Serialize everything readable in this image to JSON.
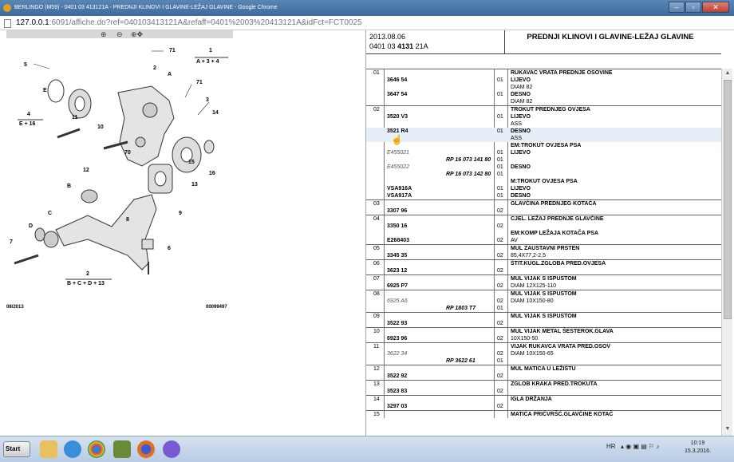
{
  "window": {
    "title": "BERLINGO (M59) - 0401 03 413121A - PREDNJI KLINOVI I GLAVINE-LEŽAJ GLAVINE - Google Chrome"
  },
  "address": {
    "host": "127.0.0.1",
    "rest": ":6091/affiche.do?ref=040103413121A&refaff=0401%2003%20413121A&idFct=FCT0025"
  },
  "diagram": {
    "footer_left": "08/2013",
    "footer_right": "00099497",
    "labels": [
      "1",
      "A + 3 + 4",
      "5",
      "E",
      "71",
      "2",
      "A",
      "4",
      "E + 16",
      "11",
      "71",
      "3",
      "14",
      "10",
      "70",
      "15",
      "16",
      "12",
      "B",
      "13",
      "9",
      "8",
      "C",
      "D",
      "7",
      "6",
      "2",
      "B + C + D + 13"
    ]
  },
  "header": {
    "date": "2013.08.06",
    "code_prefix": "0401 03",
    "code_bold": "4131",
    "code_suffix": "21A",
    "title": "PREDNJI KLINOVI I GLAVINE-LEŽAJ GLAVINE"
  },
  "groups": [
    {
      "num": "01",
      "rows": [
        {
          "ref": "",
          "qty": "",
          "text": "RUKAVAC VRATA PREDNJE OSOVINE",
          "bold": true
        },
        {
          "ref": "3646 54",
          "qty": "01",
          "text": "LIJEVO",
          "bold": true
        },
        {
          "ref": "",
          "qty": "",
          "text": "DIAM 82",
          "bold": false
        },
        {
          "ref": "3647 54",
          "qty": "01",
          "text": "DESNO",
          "bold": true
        },
        {
          "ref": "",
          "qty": "",
          "text": "DIAM 82",
          "bold": false
        }
      ]
    },
    {
      "num": "02",
      "rows": [
        {
          "ref": "",
          "qty": "",
          "text": "TROKUT PREDNJEG OVJESA",
          "bold": true
        },
        {
          "ref": "3520 V3",
          "qty": "01",
          "text": "LIJEVO",
          "bold": true
        },
        {
          "ref": "",
          "qty": "",
          "text": "ASS",
          "bold": false
        },
        {
          "ref": "3521 R4",
          "qty": "01",
          "text": "DESNO",
          "bold": true,
          "hl": true
        },
        {
          "ref": "",
          "qty": "",
          "text": "ASS",
          "bold": false,
          "hl": true
        },
        {
          "ref": "",
          "qty": "",
          "text": "EM:TROKUT OVJESA PSA",
          "bold": true
        },
        {
          "ref": "E455021",
          "qty": "01",
          "text": "LIJEVO",
          "bold": true,
          "italic": true
        },
        {
          "ref": "",
          "rp": "RP 16 073 141 80",
          "qty": "01",
          "text": ""
        },
        {
          "ref": "E455022",
          "qty": "01",
          "text": "DESNO",
          "bold": true,
          "italic": true
        },
        {
          "ref": "",
          "rp": "RP 16 073 142 80",
          "qty": "01",
          "text": ""
        },
        {
          "ref": "",
          "qty": "",
          "text": "M:TROKUT OVJESA PSA",
          "bold": true
        },
        {
          "ref": "VSA916A",
          "qty": "01",
          "text": "LIJEVO",
          "bold": true
        },
        {
          "ref": "VSA917A",
          "qty": "01",
          "text": "DESNO",
          "bold": true
        }
      ]
    },
    {
      "num": "03",
      "rows": [
        {
          "ref": "",
          "qty": "",
          "text": "GLAVČINA PREDNJEG KOTAČA",
          "bold": true
        },
        {
          "ref": "3307 96",
          "qty": "02",
          "text": "",
          "bold": false
        }
      ]
    },
    {
      "num": "04",
      "rows": [
        {
          "ref": "",
          "qty": "",
          "text": "CJEL. LEŽAJ PREDNJE GLAVČINE",
          "bold": true
        },
        {
          "ref": "3350 16",
          "qty": "02",
          "text": "",
          "bold": false
        },
        {
          "ref": "",
          "qty": "",
          "text": "EM:KOMP LEŽAJA KOTAČA PSA",
          "bold": true
        },
        {
          "ref": "E268403",
          "qty": "02",
          "text": "AV",
          "bold": false
        }
      ]
    },
    {
      "num": "05",
      "rows": [
        {
          "ref": "",
          "qty": "",
          "text": "MUL ZAUSTAVNI PRSTEN",
          "bold": true
        },
        {
          "ref": "3345 35",
          "qty": "02",
          "text": "85,4X77,2-2,5",
          "bold": false
        }
      ]
    },
    {
      "num": "06",
      "rows": [
        {
          "ref": "",
          "qty": "",
          "text": "ŠTIT.KUGL.ZGLOBA PRED.OVJESA",
          "bold": true
        },
        {
          "ref": "3623 12",
          "qty": "02",
          "text": "",
          "bold": false
        }
      ]
    },
    {
      "num": "07",
      "rows": [
        {
          "ref": "",
          "qty": "",
          "text": "MUL VIJAK S ISPUSTOM",
          "bold": true
        },
        {
          "ref": "6925 P7",
          "qty": "02",
          "text": "DIAM 12X125-110",
          "bold": false
        }
      ]
    },
    {
      "num": "08",
      "rows": [
        {
          "ref": "",
          "qty": "",
          "text": "MUL VIJAK S ISPUSTOM",
          "bold": true
        },
        {
          "ref": "6925 A6",
          "qty": "02",
          "text": "DIAM 10X150-80",
          "bold": false,
          "italic": true
        },
        {
          "ref": "",
          "rp": "RP 1803 T7",
          "qty": "01",
          "text": ""
        }
      ]
    },
    {
      "num": "09",
      "rows": [
        {
          "ref": "",
          "qty": "",
          "text": "MUL VIJAK S ISPUSTOM",
          "bold": true
        },
        {
          "ref": "3522 93",
          "qty": "02",
          "text": "",
          "bold": false
        }
      ]
    },
    {
      "num": "10",
      "rows": [
        {
          "ref": "",
          "qty": "",
          "text": "MUL VIJAK METAL ŠESTEROK.GLAVA",
          "bold": true
        },
        {
          "ref": "6923 96",
          "qty": "02",
          "text": "10X150-50",
          "bold": false
        }
      ]
    },
    {
      "num": "11",
      "rows": [
        {
          "ref": "",
          "qty": "",
          "text": "VIJAK RUKAVCA VRATA PRED.OSOV",
          "bold": true
        },
        {
          "ref": "3622 34",
          "qty": "02",
          "text": "DIAM 10X150-65",
          "bold": false,
          "italic": true
        },
        {
          "ref": "",
          "rp": "RP 3622 61",
          "qty": "01",
          "text": ""
        }
      ]
    },
    {
      "num": "12",
      "rows": [
        {
          "ref": "",
          "qty": "",
          "text": "MUL MATICA U LEŽIŠTU",
          "bold": true
        },
        {
          "ref": "3522 92",
          "qty": "02",
          "text": "",
          "bold": false
        }
      ]
    },
    {
      "num": "13",
      "rows": [
        {
          "ref": "",
          "qty": "",
          "text": "ZGLOB KRAKA PRED.TROKUTA",
          "bold": true
        },
        {
          "ref": "3523 83",
          "qty": "02",
          "text": "",
          "bold": false
        }
      ]
    },
    {
      "num": "14",
      "rows": [
        {
          "ref": "",
          "qty": "",
          "text": "IGLA DRŽANJA",
          "bold": true
        },
        {
          "ref": "3297 03",
          "qty": "02",
          "text": "",
          "bold": false
        }
      ]
    },
    {
      "num": "15",
      "rows": [
        {
          "ref": "",
          "qty": "",
          "text": "MATICA PRIČVRŠĆ.GLAVČINE KOTAČ",
          "bold": true
        }
      ]
    }
  ],
  "taskbar": {
    "start": "Start",
    "lang": "HR",
    "time": "10:19",
    "date": "15.3.2016."
  }
}
